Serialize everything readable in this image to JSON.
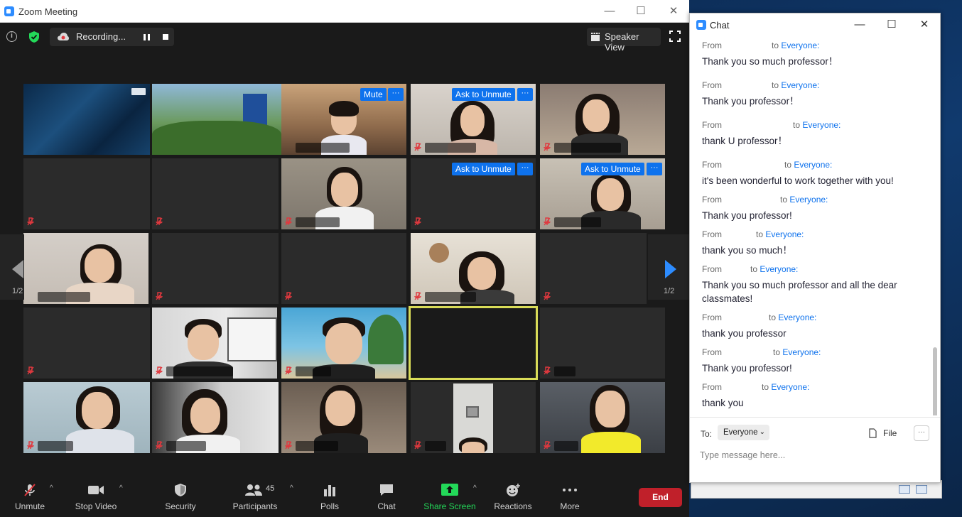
{
  "zoom_window": {
    "title": "Zoom Meeting",
    "recording_label": "Recording...",
    "view_label": "Speaker View",
    "page_indicator_left": "1/2",
    "page_indicator_right": "1/2",
    "tile_buttons": {
      "mute": "Mute",
      "ask_to_unmute": "Ask to Unmute",
      "more": "···"
    },
    "toolbar": {
      "unmute": "Unmute",
      "stop_video": "Stop Video",
      "security": "Security",
      "participants": "Participants",
      "participants_count": "45",
      "polls": "Polls",
      "chat": "Chat",
      "share_screen": "Share Screen",
      "reactions": "Reactions",
      "more": "More",
      "end": "End"
    },
    "colors": {
      "accent": "#2d8cff",
      "share_green": "#23d959",
      "end_red": "#c0202a",
      "active_speaker": "#d9dc58"
    }
  },
  "chat_window": {
    "title": "Chat",
    "messages": [
      {
        "from": "From",
        "to_prefix": "to",
        "to": "Everyone:",
        "text": "Thank you so much professor！"
      },
      {
        "from": "From",
        "to_prefix": "to",
        "to": "Everyone:",
        "text": "Thank you professor！"
      },
      {
        "from": "From",
        "to_prefix": "to",
        "to": "Everyone:",
        "text": "thank U  professor！"
      },
      {
        "from": "From",
        "to_prefix": "to",
        "to": "Everyone:",
        "text": "it's been wonderful to work together with you!"
      },
      {
        "from": "From",
        "to_prefix": "to",
        "to": "Everyone:",
        "text": "Thank you professor!"
      },
      {
        "from": "From",
        "to_prefix": "to",
        "to": "Everyone:",
        "text": "thank you so much！"
      },
      {
        "from": "From",
        "to_prefix": "to",
        "to": "Everyone:",
        "text": "Thank you so much professor and all the dear classmates!"
      },
      {
        "from": "From",
        "to_prefix": "to",
        "to": "Everyone:",
        "text": "thank you professor"
      },
      {
        "from": "From",
        "to_prefix": "to",
        "to": "Everyone:",
        "text": "Thank you professor!"
      },
      {
        "from": "From",
        "to_prefix": "to",
        "to": "Everyone:",
        "text": "thank you"
      }
    ],
    "to_label": "To:",
    "to_select": "Everyone",
    "file_label": "File",
    "more": "···",
    "input_placeholder": "Type message here..."
  }
}
